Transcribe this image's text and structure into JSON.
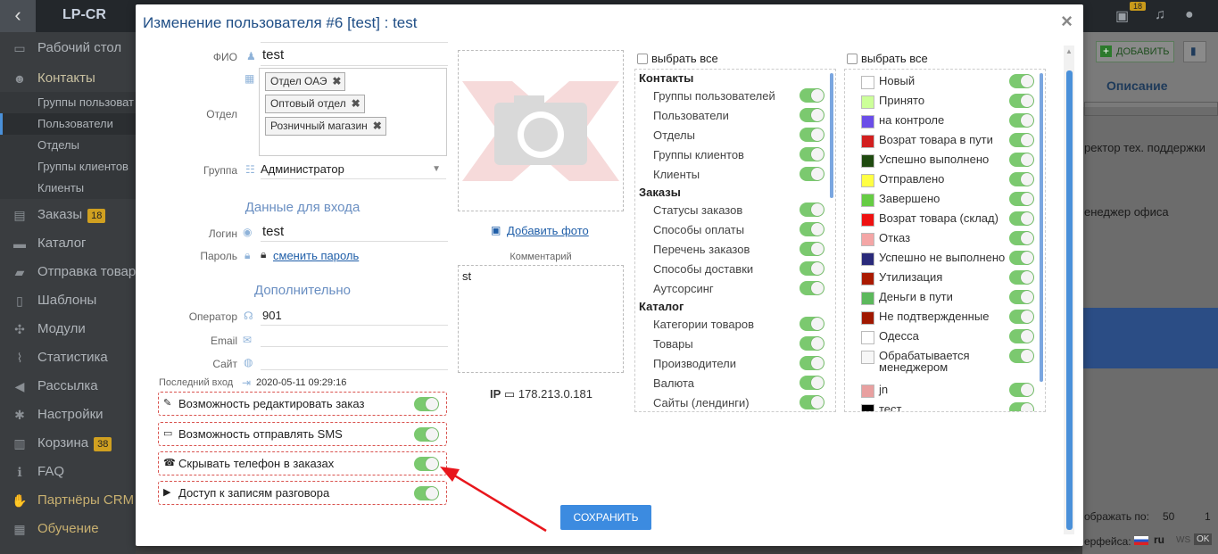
{
  "topbar": {
    "logo": "LP-CR",
    "cart_count": "18"
  },
  "sidebar": {
    "items": [
      {
        "label": "Рабочий стол",
        "icon": "monitor-icon"
      },
      {
        "label": "Контакты",
        "icon": "users-icon"
      },
      {
        "label": "Заказы",
        "icon": "money-icon",
        "badge": "18"
      },
      {
        "label": "Каталог",
        "icon": "inbox-icon"
      },
      {
        "label": "Отправка товар",
        "icon": "truck-icon"
      },
      {
        "label": "Шаблоны",
        "icon": "file-icon"
      },
      {
        "label": "Модули",
        "icon": "puzzle-icon"
      },
      {
        "label": "Статистика",
        "icon": "chart-icon"
      },
      {
        "label": "Рассылка",
        "icon": "megaphone-icon"
      },
      {
        "label": "Настройки",
        "icon": "gear-icon"
      },
      {
        "label": "Корзина",
        "icon": "trash-icon",
        "badge": "38"
      },
      {
        "label": "FAQ",
        "icon": "info-icon"
      },
      {
        "label": "Партнёры CRM",
        "icon": "handshake-icon"
      },
      {
        "label": "Обучение",
        "icon": "book-icon"
      }
    ],
    "subitems": [
      "Группы пользоват",
      "Пользователи",
      "Отделы",
      "Группы клиентов",
      "Клиенты"
    ]
  },
  "right": {
    "add": "ДОБАВИТЬ",
    "col": "Описание",
    "row1": "ректор тех. поддержки",
    "row2": "енеджер офиса",
    "perpage_label": "ображать по:",
    "perpage": "50",
    "page": "1",
    "lang_label": "ерфейса:",
    "lang": "ru",
    "ws": "WS",
    "ok": "OK"
  },
  "modal": {
    "title": "Изменение пользователя #6 [test] : test",
    "close": "×",
    "fio_label": "ФИО",
    "fio": "test",
    "dept_label": "Отдел",
    "departments": [
      "Отдел ОАЭ",
      "Оптовый отдел",
      "Розничный магазин"
    ],
    "group_label": "Группа",
    "group": "Администратор",
    "login_section": "Данные для входа",
    "login_label": "Логин",
    "login": "test",
    "password_label": "Пароль",
    "password_link": "сменить пароль",
    "extra_section": "Дополнительно",
    "operator_label": "Оператор",
    "operator": "901",
    "email_label": "Email",
    "site_label": "Сайт",
    "last_login_label": "Последний вход",
    "last_login": "2020-05-11 09:29:16",
    "toggles": [
      {
        "label": "Возможность редактировать заказ",
        "icon": "pencil-icon"
      },
      {
        "label": "Возможность отправлять SMS",
        "icon": "sms-icon"
      },
      {
        "label": "Скрывать телефон в заказах",
        "icon": "phone-icon"
      },
      {
        "label": "Доступ к записям разговора",
        "icon": "play-icon"
      }
    ],
    "add_photo": "Добавить фото",
    "comment_label": "Комментарий",
    "comment": "st",
    "ip_label": "IP",
    "ip": "178.213.0.181",
    "select_all_1": "выбрать все",
    "select_all_2": "выбрать все",
    "permissions": [
      {
        "group": "Контакты",
        "items": [
          "Группы пользователей",
          "Пользователи",
          "Отделы",
          "Группы клиентов",
          "Клиенты"
        ]
      },
      {
        "group": "Заказы",
        "items": [
          "Статусы заказов",
          "Способы оплаты",
          "Перечень заказов",
          "Способы доставки",
          "Аутсорсинг"
        ]
      },
      {
        "group": "Каталог",
        "items": [
          "Категории товаров",
          "Товары",
          "Производители",
          "Валюта",
          "Сайты (лендинги)"
        ]
      }
    ],
    "statuses": [
      {
        "label": "Новый",
        "color": "#ffffff"
      },
      {
        "label": "Принято",
        "color": "#ccff99"
      },
      {
        "label": "на контроле",
        "color": "#6a4de8"
      },
      {
        "label": "Возрат товара в пути",
        "color": "#d21f1f"
      },
      {
        "label": "Успешно выполнено",
        "color": "#1f4a10"
      },
      {
        "label": "Отправлено",
        "color": "#ffff44"
      },
      {
        "label": "Завершено",
        "color": "#66cc44"
      },
      {
        "label": "Возрат товара (склад)",
        "color": "#ee1111"
      },
      {
        "label": "Отказ",
        "color": "#f4a6a6"
      },
      {
        "label": "Успешно не выполнено",
        "color": "#2a2a7a"
      },
      {
        "label": "Утилизация",
        "color": "#aa1a00"
      },
      {
        "label": "Деньги в пути",
        "color": "#5cb85c"
      },
      {
        "label": "Не подтвержденные",
        "color": "#a01800"
      },
      {
        "label": "Одесса",
        "color": "#ffffff"
      },
      {
        "label": "Обрабатывается менеджером",
        "color": "#f7f7f7"
      },
      {
        "label": "jn",
        "color": "#e8a0a0"
      },
      {
        "label": "тест",
        "color": "#000000"
      }
    ],
    "save": "СОХРАНИТЬ"
  }
}
